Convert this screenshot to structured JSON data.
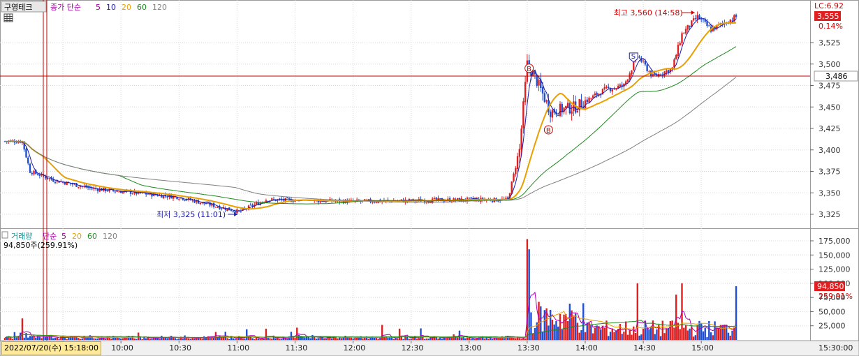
{
  "price_panel": {
    "stock_name": "구영테크",
    "series_title": "종가 단순",
    "ma_labels": [
      "5",
      "10",
      "20",
      "60",
      "120"
    ],
    "lc_label": "LC:6.92",
    "current_price": "3,555",
    "change_pct": "0.14%",
    "marker_price": "3,486",
    "high_annotation": "최고 3,560 (14:58)",
    "low_annotation": "최저 3,325 (11:01)",
    "signal_b": "B",
    "signal_s": "S",
    "y_ticks": [
      "3,525",
      "3,500",
      "3,475",
      "3,450",
      "3,425",
      "3,400",
      "3,375",
      "3,350",
      "3,325"
    ]
  },
  "volume_panel": {
    "title": "거래량",
    "ma_prefix": "단순",
    "ma_labels": [
      "5",
      "20",
      "60",
      "120"
    ],
    "current_volume": "94,850주(259.91%)",
    "volume_box": "94,850",
    "volume_pct": "259.91%",
    "y_ticks": [
      "175,000",
      "150,000",
      "125,000",
      "100,000",
      "75,000",
      "50,000",
      "25,000"
    ]
  },
  "x_axis": {
    "date_label": "2022/07/20(수) 15:18:00",
    "ticks": [
      "09:30",
      "10:00",
      "10:30",
      "11:00",
      "11:30",
      "12:00",
      "12:30",
      "13:00",
      "13:30",
      "14:00",
      "14:30",
      "15:00",
      "15:30:00"
    ]
  },
  "colors": {
    "up": "#e02020",
    "down": "#2050d0",
    "ma5": "#1a1aa8",
    "ma20": "#e8a000",
    "ma60": "#1e8a1e",
    "ma120": "#808080",
    "grid": "#d8d8d8"
  },
  "chart_data": {
    "type": "candlestick",
    "price_range": [
      3312,
      3565
    ],
    "volume_range": [
      0,
      190000
    ],
    "high": {
      "time": "14:58",
      "price": 3560
    },
    "low": {
      "time": "11:01",
      "price": 3325
    },
    "close": 3555,
    "reference_line": 3486,
    "price_path": [
      {
        "t": "09:00",
        "p": 3410
      },
      {
        "t": "09:09",
        "p": 3410
      },
      {
        "t": "09:13",
        "p": 3375
      },
      {
        "t": "09:25",
        "p": 3365
      },
      {
        "t": "09:45",
        "p": 3355
      },
      {
        "t": "10:30",
        "p": 3345
      },
      {
        "t": "11:01",
        "p": 3328
      },
      {
        "t": "11:15",
        "p": 3342
      },
      {
        "t": "12:00",
        "p": 3340
      },
      {
        "t": "13:00",
        "p": 3342
      },
      {
        "t": "13:20",
        "p": 3342
      },
      {
        "t": "13:26",
        "p": 3400
      },
      {
        "t": "13:30",
        "p": 3500
      },
      {
        "t": "13:35",
        "p": 3480
      },
      {
        "t": "13:42",
        "p": 3445
      },
      {
        "t": "13:55",
        "p": 3450
      },
      {
        "t": "14:10",
        "p": 3470
      },
      {
        "t": "14:20",
        "p": 3475
      },
      {
        "t": "14:27",
        "p": 3510
      },
      {
        "t": "14:35",
        "p": 3485
      },
      {
        "t": "14:45",
        "p": 3495
      },
      {
        "t": "14:50",
        "p": 3535
      },
      {
        "t": "14:58",
        "p": 3555
      },
      {
        "t": "15:05",
        "p": 3540
      },
      {
        "t": "15:18",
        "p": 3555
      }
    ],
    "ma_series": [
      {
        "name": "5",
        "values": []
      },
      {
        "name": "20",
        "values": []
      },
      {
        "name": "60",
        "values": []
      },
      {
        "name": "120",
        "values": []
      }
    ],
    "volume_peaks": [
      {
        "t": "13:30",
        "v": 178000
      },
      {
        "t": "13:31",
        "v": 160000
      },
      {
        "t": "14:27",
        "v": 100000
      },
      {
        "t": "14:47",
        "v": 80000
      },
      {
        "t": "14:50",
        "v": 100000
      },
      {
        "t": "15:18",
        "v": 94850
      }
    ]
  }
}
